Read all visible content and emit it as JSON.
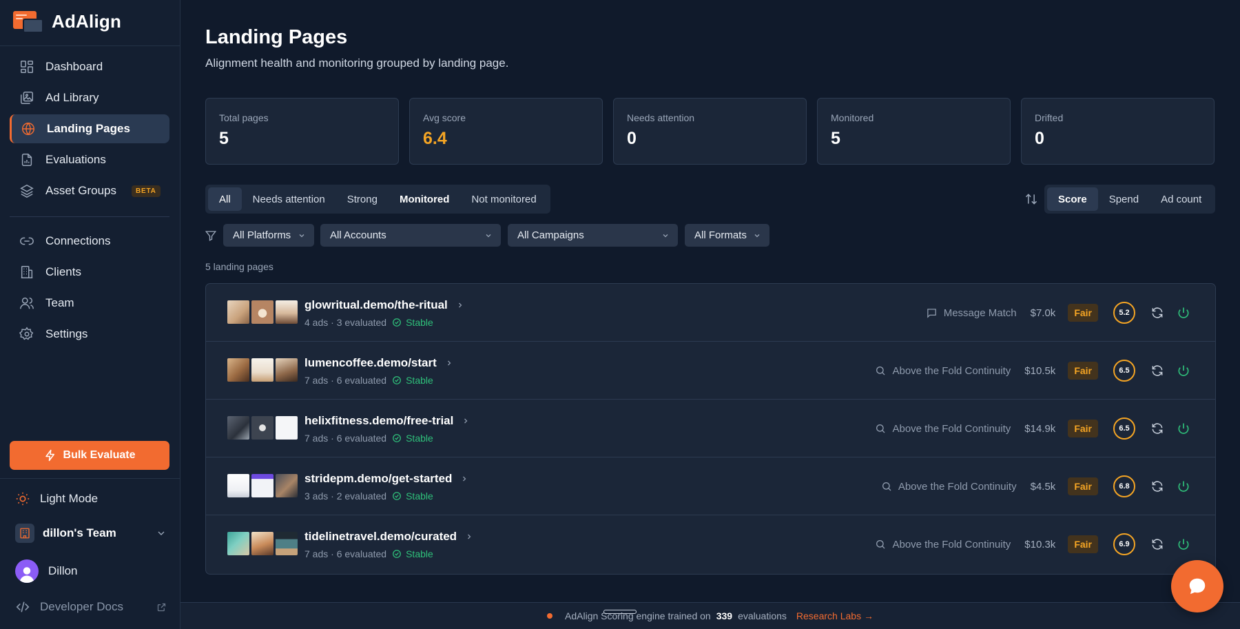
{
  "app": {
    "name": "AdAlign"
  },
  "sidebar": {
    "items": [
      {
        "label": "Dashboard",
        "icon": "dashboard-icon"
      },
      {
        "label": "Ad Library",
        "icon": "image-library-icon"
      },
      {
        "label": "Landing Pages",
        "icon": "globe-icon",
        "active": true
      },
      {
        "label": "Evaluations",
        "icon": "document-chart-icon"
      },
      {
        "label": "Asset Groups",
        "icon": "layers-icon",
        "badge": "BETA"
      },
      {
        "label": "Connections",
        "icon": "link-icon"
      },
      {
        "label": "Clients",
        "icon": "building-icon"
      },
      {
        "label": "Team",
        "icon": "users-icon"
      },
      {
        "label": "Settings",
        "icon": "gear-icon"
      }
    ],
    "bulk_evaluate": "Bulk Evaluate",
    "light_mode": "Light Mode",
    "team": "dillon's Team",
    "user": "Dillon",
    "developer_docs": "Developer Docs"
  },
  "page": {
    "title": "Landing Pages",
    "subtitle": "Alignment health and monitoring grouped by landing page."
  },
  "stats": [
    {
      "label": "Total pages",
      "value": "5"
    },
    {
      "label": "Avg score",
      "value": "6.4",
      "color": "#f5a524"
    },
    {
      "label": "Needs attention",
      "value": "0"
    },
    {
      "label": "Monitored",
      "value": "5"
    },
    {
      "label": "Drifted",
      "value": "0"
    }
  ],
  "filter_tabs": [
    "All",
    "Needs attention",
    "Strong",
    "Monitored",
    "Not monitored"
  ],
  "sort_tabs": [
    "Score",
    "Spend",
    "Ad count"
  ],
  "dropdowns": [
    "All Platforms",
    "All Accounts",
    "All Campaigns",
    "All Formats"
  ],
  "count_label": "5 landing pages",
  "rows": [
    {
      "name": "glowritual.demo/the-ritual",
      "meta": "4 ads · 3 evaluated",
      "status": "Stable",
      "insight": "Message Match",
      "insight_icon": "message-icon",
      "spend": "$7.0k",
      "badge": "Fair",
      "score": "5.2"
    },
    {
      "name": "lumencoffee.demo/start",
      "meta": "7 ads · 6 evaluated",
      "status": "Stable",
      "insight": "Above the Fold Continuity",
      "insight_icon": "search-icon",
      "spend": "$10.5k",
      "badge": "Fair",
      "score": "6.5"
    },
    {
      "name": "helixfitness.demo/free-trial",
      "meta": "7 ads · 6 evaluated",
      "status": "Stable",
      "insight": "Above the Fold Continuity",
      "insight_icon": "search-icon",
      "spend": "$14.9k",
      "badge": "Fair",
      "score": "6.5"
    },
    {
      "name": "stridepm.demo/get-started",
      "meta": "3 ads · 2 evaluated",
      "status": "Stable",
      "insight": "Above the Fold Continuity",
      "insight_icon": "search-icon",
      "spend": "$4.5k",
      "badge": "Fair",
      "score": "6.8"
    },
    {
      "name": "tidelinetravel.demo/curated",
      "meta": "7 ads · 6 evaluated",
      "status": "Stable",
      "insight": "Above the Fold Continuity",
      "insight_icon": "search-icon",
      "spend": "$10.3k",
      "badge": "Fair",
      "score": "6.9"
    }
  ],
  "footer": {
    "text_pre": "AdAlign Scoring engine trained on",
    "count": "339",
    "text_post": "evaluations",
    "link": "Research Labs →"
  },
  "colors": {
    "accent": "#f26b30",
    "warning": "#f5a524",
    "success": "#2fc07a"
  }
}
